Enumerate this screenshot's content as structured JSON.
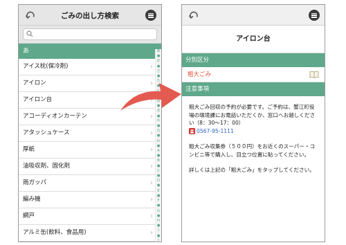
{
  "left_screen": {
    "title": "ごみの出し方検索",
    "search": {
      "placeholder": "",
      "value": ""
    },
    "section_header": "あ",
    "items": [
      "アイス枕(保冷剤)",
      "アイロン",
      "アイロン台",
      "アコーディオンカーテン",
      "アタッシュケース",
      "厚紙",
      "油吸収剤、固化剤",
      "雨ガッパ",
      "編み機",
      "網戸",
      "アルミ缶(飲料、食品用)"
    ],
    "index": [
      "あ",
      "●",
      "か",
      "●",
      "さ",
      "●",
      "た",
      "●",
      "な",
      "●",
      "は",
      "●",
      "ま",
      "●",
      "や",
      "●",
      "ら",
      "●",
      "わ",
      "●",
      "A",
      "●",
      "B",
      "●",
      "C",
      "●",
      "D",
      "●",
      "E",
      "●",
      "F",
      "●",
      "G",
      "●",
      "H",
      "●",
      "I",
      "●",
      "J",
      "●"
    ]
  },
  "right_screen": {
    "title": "アイロン台",
    "category_header": "分別区分",
    "category": "粗大ごみ",
    "notes_header": "注意事項",
    "note1": "粗大ごみ回収の予約が必要です。ご予約は、蟹江町役場の環境課にお電話いただくか、窓口へお越しください（8：30〜17：00）",
    "phone": "0567-95-1111",
    "note2": "粗大ごみ収集券（５００円）をお近くのスーパー・コンビニ等で購入し、目立つ位置に貼ってください。",
    "note3": "詳しくは上記の「粗大ごみ」をタップしてください。"
  },
  "colors": {
    "accent_green": "#5fa88b",
    "arrow_red": "#e35a50",
    "link_red": "#e0533a",
    "link_blue": "#2a5fc4"
  }
}
